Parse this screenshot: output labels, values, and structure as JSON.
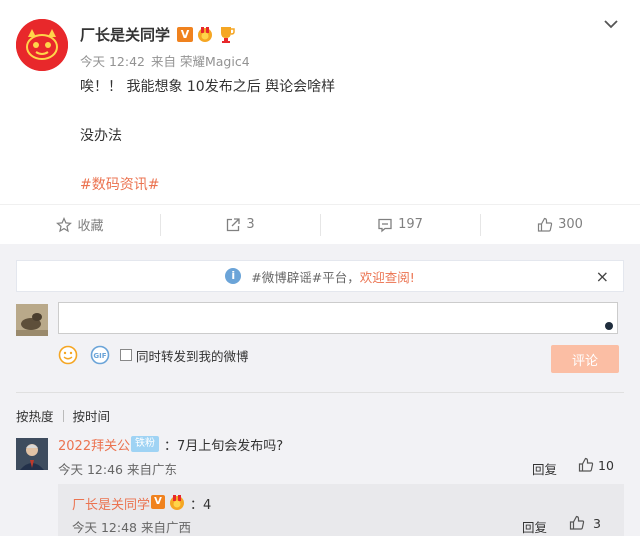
{
  "post": {
    "author": "厂长是关同学",
    "verified_badge": "V",
    "time": "今天 12:42",
    "source": "来自 荣耀Magic4",
    "content_line1": "唉！！ 我能想象 10发布之后 舆论会啥样",
    "content_line2": "没办法",
    "topic": "#数码资讯#"
  },
  "actions": {
    "favorite_label": "收藏",
    "forward_count": "3",
    "comment_count": "197",
    "like_count": "300"
  },
  "notice": {
    "prefix": "#微博辟谣#平台，",
    "link": "欢迎查阅!",
    "info_glyph": "i",
    "close_glyph": "×"
  },
  "composer": {
    "input_value": "",
    "gif_label": "GIF",
    "share_label": "同时转发到我的微博",
    "submit_label": "评论"
  },
  "sort": {
    "by_hot": "按热度",
    "by_time": "按时间"
  },
  "comments": [
    {
      "name": "2022拜关公",
      "badge": "铁粉",
      "text": "：7月上旬会发布吗?",
      "meta": "今天 12:46 来自广东",
      "reply_label": "回复",
      "likes": "10"
    }
  ],
  "reply": {
    "name": "厂长是关同学",
    "verified_badge": "V",
    "text": "：4",
    "meta": "今天 12:48 来自广西",
    "reply_label": "回复",
    "likes": "3"
  },
  "colors": {
    "accent": "#eb7350",
    "verified": "#f0821e",
    "submit_disabled": "#fbbea4",
    "notice_link": "#eb7350"
  },
  "icons": [
    "chevron-down-icon",
    "star-icon",
    "forward-icon",
    "comment-icon",
    "thumbs-up-icon",
    "info-icon",
    "close-icon",
    "smiley-icon",
    "gif-icon",
    "medal-icon",
    "trophy-icon"
  ]
}
